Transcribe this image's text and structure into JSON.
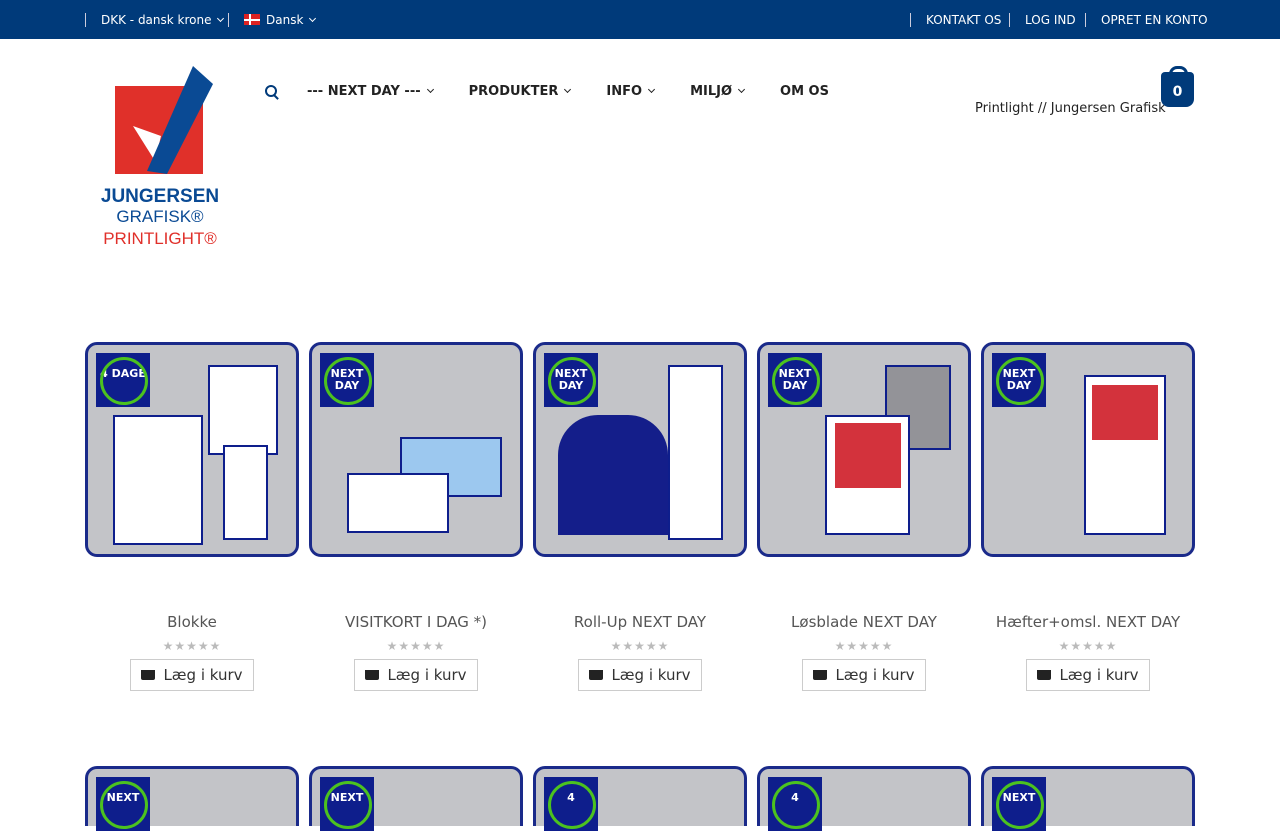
{
  "topbar": {
    "currency": "DKK - dansk krone",
    "language": "Dansk",
    "links": [
      "KONTAKT OS",
      "LOG IND",
      "OPRET EN KONTO"
    ]
  },
  "logo": {
    "text": [
      "JUNGERSEN",
      "GRAFISK®",
      "PRINTLIGHT®"
    ]
  },
  "nav": [
    "--- NEXT DAY ---",
    "PRODUKTER",
    "INFO",
    "MILJØ",
    "OM OS"
  ],
  "header": {
    "brand": "Printlight // Jungersen Grafisk",
    "cart_count": "0"
  },
  "products": [
    {
      "title": "Blokke",
      "badge": "4 DAGE",
      "button": "Læg i kurv",
      "rating": 0
    },
    {
      "title": "VISITKORT I DAG *)",
      "badge": "NEXT DAY",
      "button": "Læg i kurv",
      "rating": 0
    },
    {
      "title": "Roll-Up NEXT DAY",
      "badge": "NEXT DAY",
      "button": "Læg i kurv",
      "rating": 0
    },
    {
      "title": "Løsblade NEXT DAY",
      "badge": "NEXT DAY",
      "button": "Læg i kurv",
      "rating": 0
    },
    {
      "title": "Hæfter+omsl. NEXT DAY",
      "badge": "NEXT DAY",
      "button": "Læg i kurv",
      "rating": 0
    }
  ],
  "row2_badges": [
    "NEXT",
    "NEXT",
    "4",
    "4",
    "NEXT"
  ]
}
